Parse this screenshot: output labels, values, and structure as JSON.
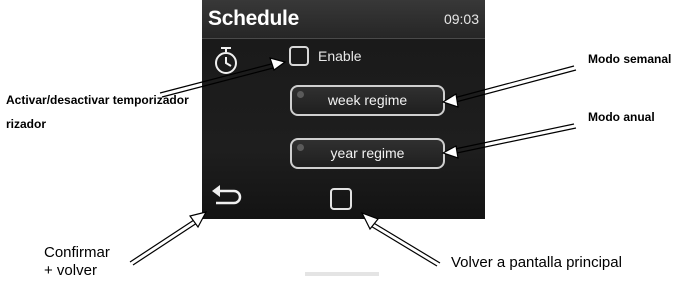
{
  "screen": {
    "title": "Schedule",
    "time": "09:03",
    "enable_label": "Enable",
    "week_button_label": "week regime",
    "year_button_label": "year regime",
    "enable_checked": false
  },
  "annotations": {
    "activar_line1": "Activar/desactivar temporizador",
    "activar_line2": "rizador",
    "semanal": "Modo semanal",
    "anual": "Modo anual",
    "confirmar_line1": "Confirmar",
    "confirmar_line2": "+ volver",
    "volver": "Volver a pantalla principal"
  },
  "icons": {
    "timer": "stopwatch-icon",
    "back": "back-arrow-icon",
    "home": "home-square-icon"
  },
  "colors": {
    "screen_bg": "#1e1e1e",
    "header_bg": "#2e2e2e",
    "button_border": "#cfcfcf",
    "annotation_text": "#000000"
  }
}
